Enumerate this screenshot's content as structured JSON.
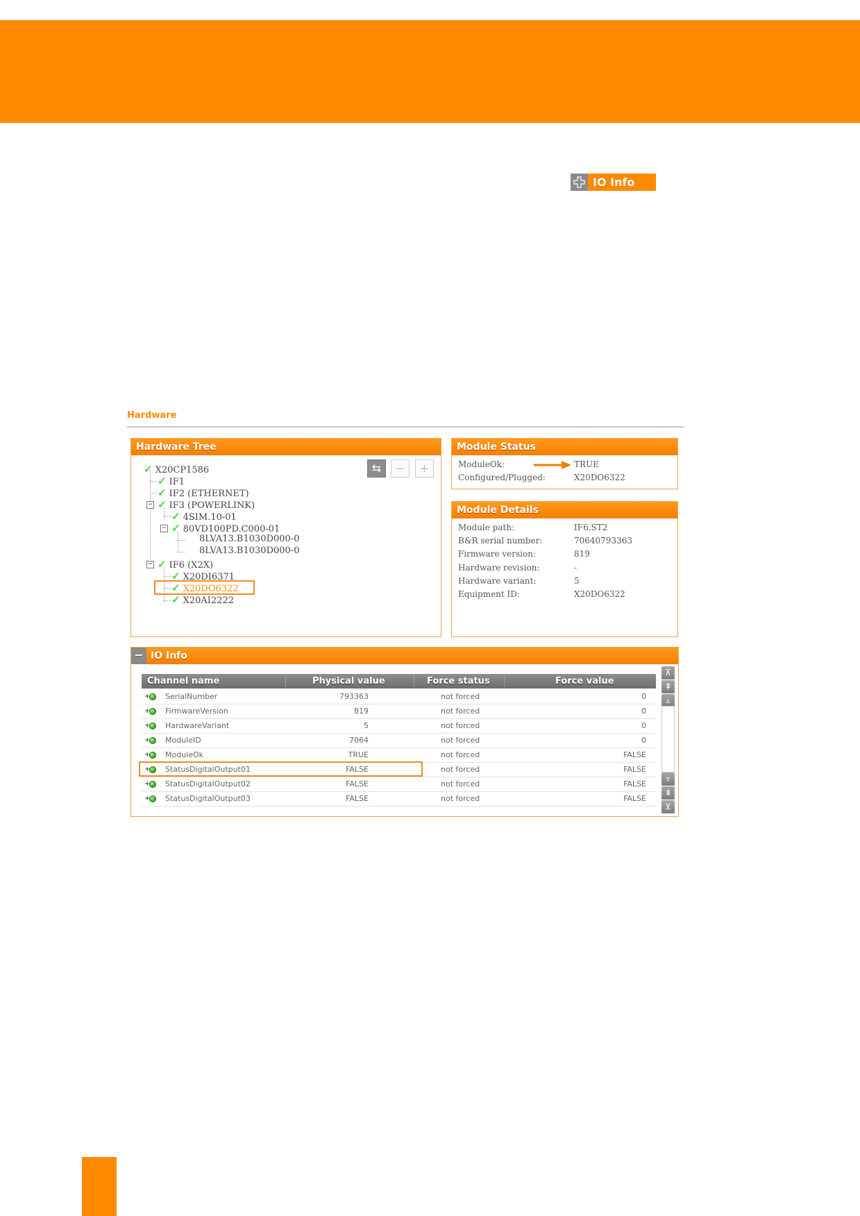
{
  "io_info_chip": {
    "label": "IO Info"
  },
  "hardware_section": {
    "title": "Hardware"
  },
  "hardware_tree": {
    "title": "Hardware Tree",
    "nodes": [
      {
        "label": "X20CP1586"
      },
      {
        "label": "IF1"
      },
      {
        "label": "IF2 (ETHERNET)"
      },
      {
        "label": "IF3 (POWERLINK)"
      },
      {
        "label": "4SIM.10-01"
      },
      {
        "label": "80VD100PD.C000-01"
      },
      {
        "label": "8LVA13.B1030D000-0"
      },
      {
        "label": "8LVA13.B1030D000-0"
      },
      {
        "label": "IF6 (X2X)"
      },
      {
        "label": "X20DI6371"
      },
      {
        "label": "X20DO6322"
      },
      {
        "label": "X20AI2222"
      }
    ]
  },
  "module_status": {
    "title": "Module Status",
    "rows": [
      {
        "label": "ModuleOk:",
        "value": "TRUE"
      },
      {
        "label": "Configured/Plugged:",
        "value": "X20DO6322"
      }
    ]
  },
  "module_details": {
    "title": "Module Details",
    "rows": [
      {
        "label": "Module path:",
        "value": "IF6.ST2"
      },
      {
        "label": "B&R serial number:",
        "value": "70640793363"
      },
      {
        "label": "Firmware version:",
        "value": "819"
      },
      {
        "label": "Hardware revision:",
        "value": "-"
      },
      {
        "label": "Hardware variant:",
        "value": "5"
      },
      {
        "label": "Equipment ID:",
        "value": "X20DO6322"
      }
    ]
  },
  "io_info": {
    "title": "IO Info",
    "columns": [
      "Channel name",
      "Physical value",
      "Force status",
      "Force value"
    ],
    "rows": [
      {
        "channel": "SerialNumber",
        "physical": "793363",
        "force_status": "not forced",
        "force_value": "0"
      },
      {
        "channel": "FirmwareVersion",
        "physical": "819",
        "force_status": "not forced",
        "force_value": "0"
      },
      {
        "channel": "HardwareVariant",
        "physical": "5",
        "force_status": "not forced",
        "force_value": "0"
      },
      {
        "channel": "ModuleID",
        "physical": "7064",
        "force_status": "not forced",
        "force_value": "0"
      },
      {
        "channel": "ModuleOk",
        "physical": "TRUE",
        "force_status": "not forced",
        "force_value": "FALSE"
      },
      {
        "channel": "StatusDigitalOutput01",
        "physical": "FALSE",
        "force_status": "not forced",
        "force_value": "FALSE"
      },
      {
        "channel": "StatusDigitalOutput02",
        "physical": "FALSE",
        "force_status": "not forced",
        "force_value": "FALSE"
      },
      {
        "channel": "StatusDigitalOutput03",
        "physical": "FALSE",
        "force_status": "not forced",
        "force_value": "FALSE"
      }
    ]
  },
  "colors": {
    "accent": "#ff8a00",
    "check": "#4ad43c",
    "highlight": "#f08a24"
  }
}
